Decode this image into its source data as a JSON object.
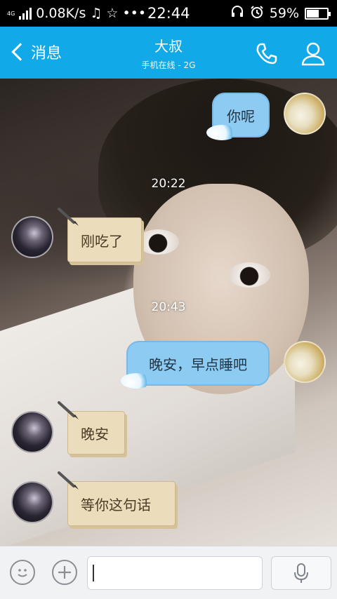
{
  "status_bar": {
    "network_tag": "4G",
    "speed": "0.08K/s",
    "dots": "•••",
    "time": "22:44",
    "battery": "59%",
    "battery_level": 0.59
  },
  "header": {
    "back_label": "消息",
    "title": "大叔",
    "subtitle": "手机在线 - 2G"
  },
  "messages": [
    {
      "side": "self",
      "text": "你呢"
    },
    {
      "timestamp": "20:22"
    },
    {
      "side": "other",
      "text": "刚吃了"
    },
    {
      "timestamp": "20:43"
    },
    {
      "side": "self",
      "text": "晚安，早点睡吧"
    },
    {
      "side": "other",
      "text": "晚安"
    },
    {
      "side": "other",
      "text": "等你这句话"
    }
  ],
  "input": {
    "value": "",
    "placeholder": ""
  },
  "icons": {
    "music": "music-note-icon",
    "call": "phone-icon",
    "profile": "person-icon",
    "emoji": "smiley-icon",
    "plus": "plus-icon",
    "mic": "microphone-icon"
  },
  "colors": {
    "header_bg": "#12a9e8",
    "bubble_self": "#8ecbf2",
    "bubble_other": "#ebdcbb"
  }
}
